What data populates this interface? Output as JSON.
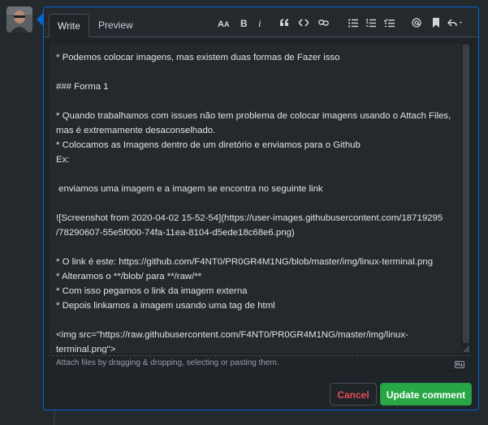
{
  "tabs": {
    "write": "Write",
    "preview": "Preview"
  },
  "toolbar": {
    "icons": [
      "text-size-icon",
      "bold-icon",
      "italic-icon",
      "quote-icon",
      "code-icon",
      "link-icon",
      "unordered-list-icon",
      "ordered-list-icon",
      "task-list-icon",
      "mention-icon",
      "bookmark-icon",
      "reply-icon"
    ]
  },
  "editor": {
    "lines": [
      "* Podemos colocar imagens, mas existem duas formas de Fazer isso",
      "",
      "### Forma 1",
      "",
      "* Quando trabalhamos com issues não tem problema de colocar imagens usando o Attach Files,",
      "mas é extremamente desaconselhado.",
      "* Colocamos as Imagens dentro de um diretório e enviamos para o Github",
      "Ex:",
      "",
      " enviamos uma imagem e a imagem se encontra no seguinte link",
      "",
      "![Screenshot from 2020-04-02 15-52-54](https://user-images.githubusercontent.com/18719295",
      "/78290607-55e5f000-74fa-11ea-8104-d5ede18c68e6.png)",
      "",
      "* O link é este: https://github.com/F4NT0/PR0GR4M1NG/blob/master/img/linux-terminal.png",
      "* Alteramos o **/blob/ para **/raw/**",
      "* Com isso pegamos o link da imagem externa",
      "* Depois linkamos a imagem usando uma tag de html",
      "",
      "<img src=\"https://raw.githubusercontent.com/F4NT0/PR0GR4M1NG/master/img/linux-",
      "terminal.png\">"
    ]
  },
  "attach": {
    "text": "Attach files by dragging & dropping, selecting or pasting them."
  },
  "buttons": {
    "cancel": "Cancel",
    "update": "Update comment"
  },
  "colors": {
    "accent_blue": "#0366d6",
    "primary_green": "#28a745",
    "danger_red": "#ea4a5a"
  }
}
